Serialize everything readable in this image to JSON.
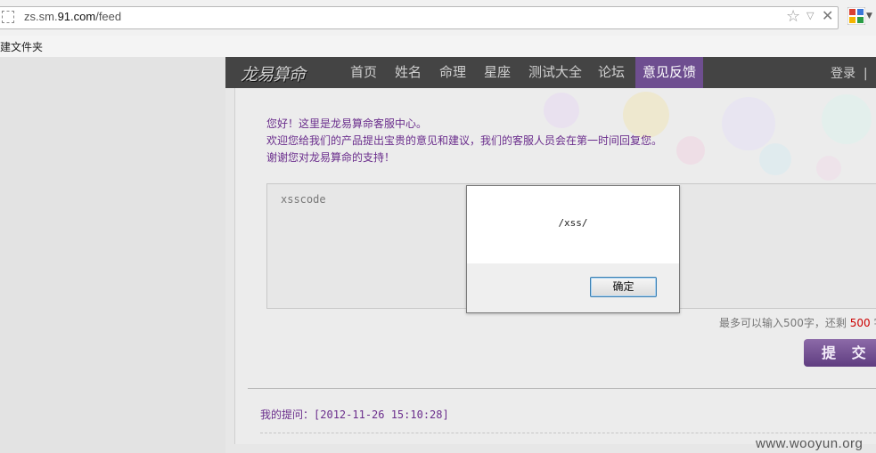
{
  "browser": {
    "url_prefix": "zs.sm.",
    "url_domain": "91.com",
    "url_path": "/feed",
    "bookmark_text": "建文件夹"
  },
  "site": {
    "logo_text": "龙易算命",
    "nav": [
      "首页",
      "姓名",
      "命理",
      "星座",
      "测试大全",
      "论坛",
      "意见反馈"
    ],
    "nav_active_index": 6,
    "login": "登录",
    "login_sep": "|",
    "accent_color": "#6e4e90"
  },
  "feedback": {
    "greeting_lines": [
      "您好！这里是龙易算命客服中心。",
      "欢迎您给我们的产品提出宝贵的意见和建议，我们的客服人员会在第一时间回复您。",
      "谢谢您对龙易算命的支持！"
    ],
    "textarea_value": "xsscode",
    "limit_prefix": "最多可以输入500字，还剩",
    "limit_remaining": "500",
    "limit_suffix": "字",
    "submit_label": "提 交",
    "my_question_label": "我的提问：",
    "my_question_time": "[2012-11-26 15:10:28]"
  },
  "alert": {
    "message": "/xss/",
    "ok_label": "确定"
  },
  "watermark": "www.wooyun.org"
}
